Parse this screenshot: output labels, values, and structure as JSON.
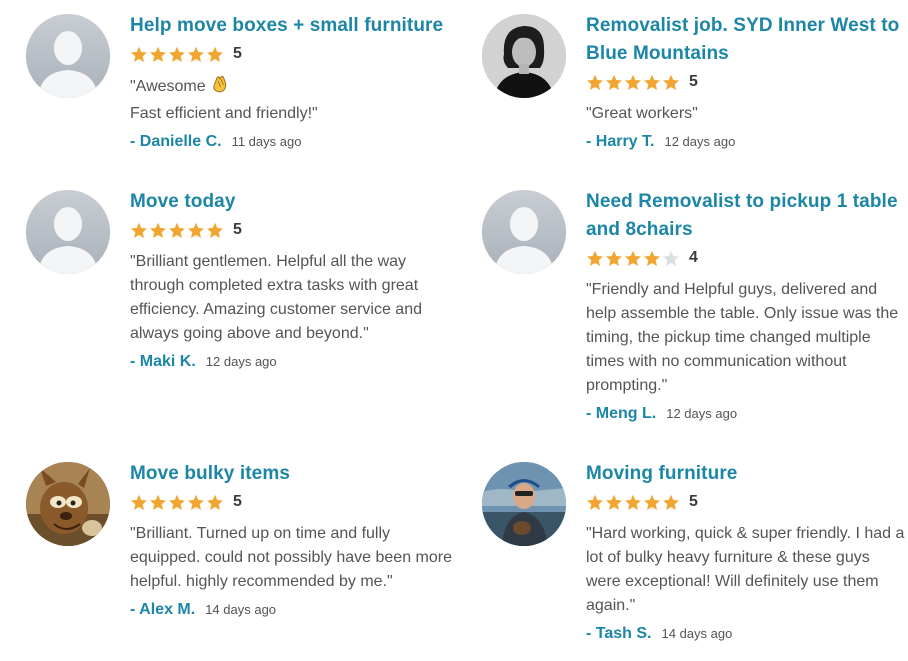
{
  "colors": {
    "accent": "#1c86a6",
    "star_filled": "#f2a531",
    "star_empty": "#dcdfe3",
    "text": "#545454"
  },
  "reviews": [
    {
      "title": "Help move boxes + small furniture",
      "rating": 5,
      "rating_text": "5",
      "quote": "\"Awesome ",
      "quote_tail": "\nFast efficient and friendly!\"",
      "emoji_icon": "clapping-hands-icon",
      "author": "- Danielle C.",
      "date": "11 days ago",
      "avatar": "default"
    },
    {
      "title": "Removalist job. SYD Inner West to Blue Mountains",
      "rating": 5,
      "rating_text": "5",
      "quote": "\"Great workers\"",
      "author": "- Harry T.",
      "date": "12 days ago",
      "avatar": "photo-bw"
    },
    {
      "title": "Move today",
      "rating": 5,
      "rating_text": "5",
      "quote": "\"Brilliant gentlemen. Helpful all the way through completed extra tasks with great efficiency. Amazing customer service and always going above and beyond.\"",
      "author": "- Maki K.",
      "date": "12 days ago",
      "avatar": "default"
    },
    {
      "title": "Need Removalist to pickup 1 table and 8chairs",
      "rating": 4,
      "rating_text": "4",
      "quote": "\"Friendly and Helpful guys, delivered and help assemble the table. Only issue was the timing, the pickup time changed multiple times with no communication without prompting.\"",
      "author": "- Meng L.",
      "date": "12 days ago",
      "avatar": "default"
    },
    {
      "title": "Move bulky items",
      "rating": 5,
      "rating_text": "5",
      "quote": "\"Brilliant.  Turned up on time and fully equipped.  could not possibly have been more helpful.  highly recommended by me.\"",
      "author": "- Alex M.",
      "date": "14 days ago",
      "avatar": "cartoon"
    },
    {
      "title": "Moving furniture",
      "rating": 5,
      "rating_text": "5",
      "quote": "\"Hard working, quick & super friendly. I had a lot of bulky heavy furniture & these guys were exceptional! Will definitely use them again.\"",
      "author": "- Tash S.",
      "date": "14 days ago",
      "avatar": "photo-outdoor"
    }
  ]
}
